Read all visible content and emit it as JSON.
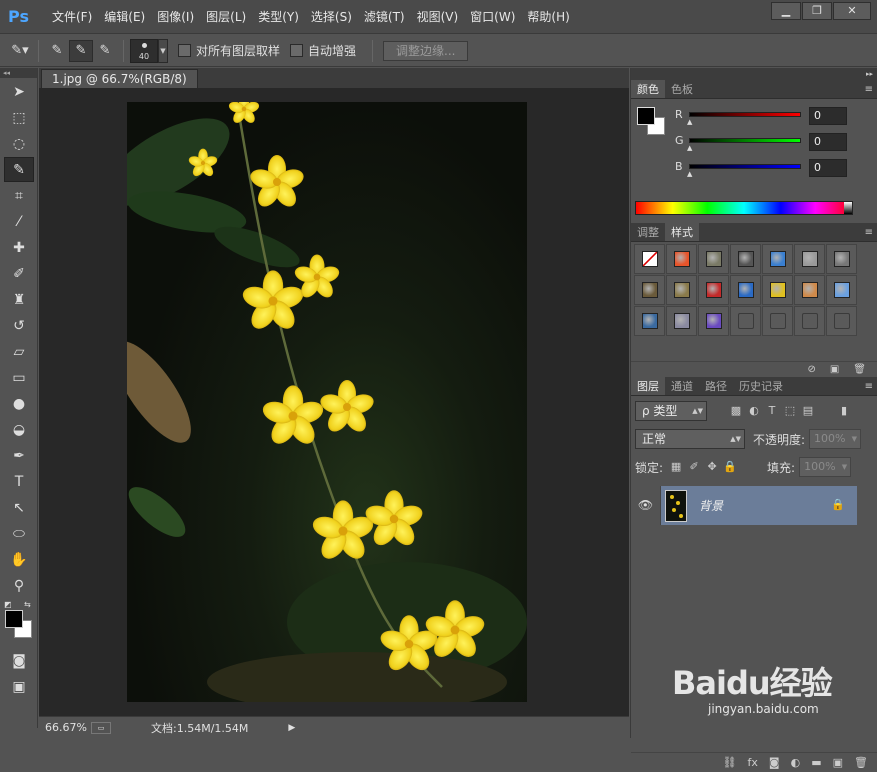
{
  "app": {
    "logo": "Ps",
    "menu": [
      "文件(F)",
      "编辑(E)",
      "图像(I)",
      "图层(L)",
      "类型(Y)",
      "选择(S)",
      "滤镜(T)",
      "视图(V)",
      "窗口(W)",
      "帮助(H)"
    ],
    "window_controls": [
      "▁",
      "❐",
      "✕"
    ]
  },
  "options_bar": {
    "brush_size": "40",
    "sample_all_layers_label": "对所有图层取样",
    "auto_enhance_label": "自动增强",
    "refine_edge_label": "调整边缘..."
  },
  "document": {
    "tab_title": "1.jpg @ 66.7%(RGB/8)"
  },
  "status": {
    "zoom": "66.67%",
    "doc_size": "文档:1.54M/1.54M"
  },
  "color_panel": {
    "tabs": [
      "颜色",
      "色板"
    ],
    "channels": [
      {
        "label": "R",
        "value": "0",
        "gradient": "linear-gradient(to right,#000,#ff0000)"
      },
      {
        "label": "G",
        "value": "0",
        "gradient": "linear-gradient(to right,#000,#00ff00)"
      },
      {
        "label": "B",
        "value": "0",
        "gradient": "linear-gradient(to right,#000,#0000ff)"
      }
    ]
  },
  "styles_panel": {
    "tabs": [
      "调整",
      "样式"
    ],
    "swatches": [
      "none",
      "#e8542a",
      "#7a7a66",
      "#555555",
      "#3a7fd0",
      "#9a9a9a",
      "#777777",
      "#6a5a3a",
      "#8a7a4a",
      "#c42a2a",
      "#2a6ac4",
      "#e0c020",
      "#d08a4a",
      "#6aa0e0",
      "#3a6aa0",
      "#8a8aa0",
      "#6a4ac0",
      "",
      "",
      "",
      ""
    ]
  },
  "layers_panel": {
    "tabs": [
      "图层",
      "通道",
      "路径",
      "历史记录"
    ],
    "filter_label": "ρ 类型",
    "blend_mode": "正常",
    "opacity_label": "不透明度:",
    "opacity_value": "100%",
    "lock_label": "锁定:",
    "fill_label": "填充:",
    "fill_value": "100%",
    "layers": [
      {
        "name": "背景",
        "visible": true,
        "locked": true
      }
    ],
    "footer_icons": [
      "link-icon",
      "fx-icon",
      "mask-icon",
      "adjustment-icon",
      "folder-icon",
      "new-layer-icon",
      "trash-icon"
    ]
  },
  "watermark": {
    "brand": "Baidu经验",
    "url": "jingyan.baidu.com"
  }
}
